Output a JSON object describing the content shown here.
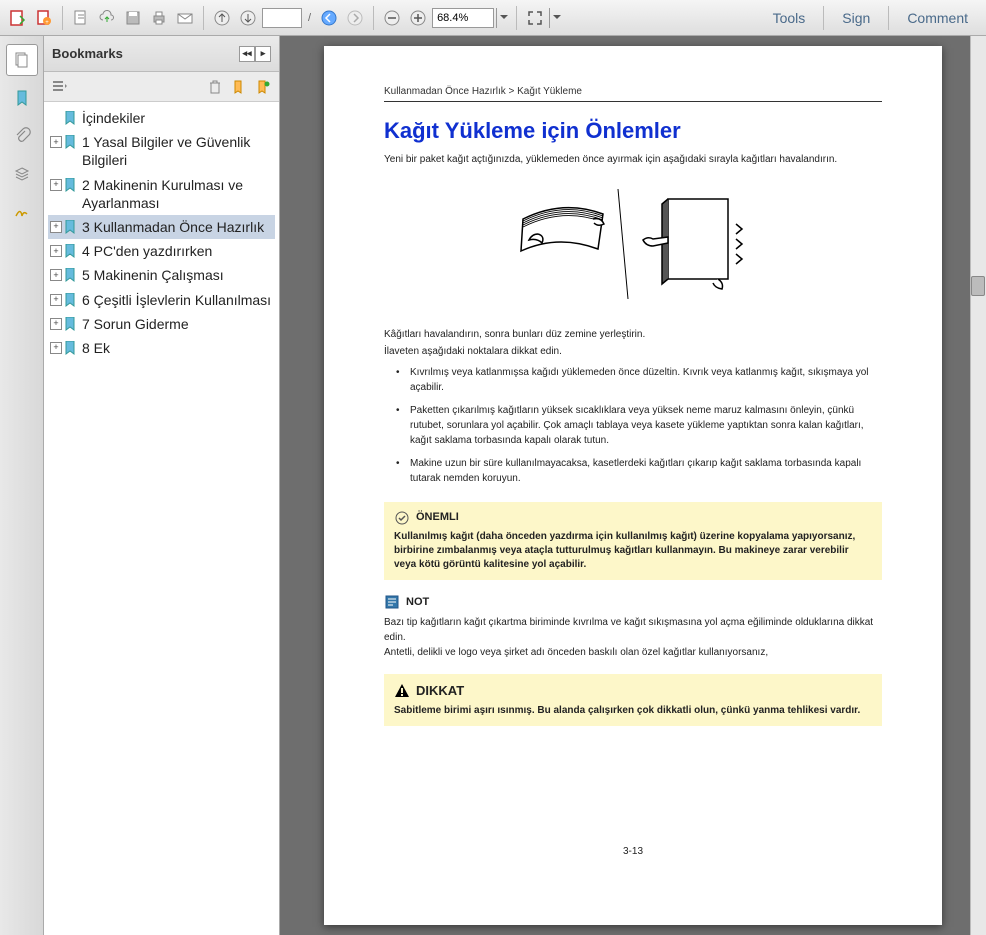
{
  "toolbar": {
    "page_current": "",
    "page_total": "/",
    "zoom": "68.4%",
    "tools_label": "Tools",
    "sign_label": "Sign",
    "comment_label": "Comment"
  },
  "bookmarks": {
    "title": "Bookmarks",
    "items": [
      {
        "label": "İçindekiler",
        "expandable": false
      },
      {
        "label": "1 Yasal Bilgiler ve Güvenlik Bilgileri",
        "expandable": true
      },
      {
        "label": "2 Makinenin Kurulması ve Ayarlanması",
        "expandable": true
      },
      {
        "label": "3 Kullanmadan Önce Hazırlık",
        "expandable": true,
        "selected": true
      },
      {
        "label": "4 PC'den yazdırırken",
        "expandable": true
      },
      {
        "label": "5 Makinenin Çalışması",
        "expandable": true
      },
      {
        "label": "6 Çeşitli İşlevlerin Kullanılması",
        "expandable": true
      },
      {
        "label": "7 Sorun Giderme",
        "expandable": true
      },
      {
        "label": "8 Ek",
        "expandable": true
      }
    ]
  },
  "document": {
    "breadcrumb": "Kullanmadan Önce Hazırlık > Kağıt Yükleme",
    "title": "Kağıt Yükleme için Önlemler",
    "intro": "Yeni bir paket kağıt açtığınızda, yüklemeden önce ayırmak için aşağıdaki sırayla kağıtları havalandırın.",
    "line1": "Kâğıtları havalandırın, sonra bunları düz zemine yerleştirin.",
    "line2": "İlaveten aşağıdaki noktalara dikkat edin.",
    "bullets": [
      "Kıvrılmış veya katlanmışsa kağıdı yüklemeden önce düzeltin. Kıvrık veya katlanmış kağıt, sıkışmaya yol açabilir.",
      "Paketten çıkarılmış kağıtların yüksek sıcaklıklara veya yüksek neme maruz kalmasını önleyin, çünkü rutubet, sorunlara yol açabilir. Çok amaçlı tablaya veya kasete yükleme yaptıktan sonra kalan kağıtları, kağıt saklama torbasında kapalı olarak tutun.",
      "Makine uzun bir süre kullanılmayacaksa, kasetlerdeki kağıtları çıkarıp kağıt saklama torbasında kapalı tutarak nemden koruyun."
    ],
    "important": {
      "header": "ÖNEMLI",
      "body": "Kullanılmış kağıt (daha önceden yazdırma için kullanılmış kağıt) üzerine kopyalama yapıyorsanız, birbirine zımbalanmış veya ataçla tutturulmuş kağıtları kullanmayın. Bu makineye zarar verebilir veya kötü görüntü kalitesine yol açabilir."
    },
    "note": {
      "header": "NOT",
      "body1": "Bazı tip kağıtların kağıt çıkartma biriminde kıvrılma ve kağıt sıkışmasına yol açma eğiliminde olduklarına dikkat edin.",
      "body2_prefix": "Antetli, delikli ve logo veya şirket adı önceden baskılı olan özel kağıtlar kullanıyorsanız,",
      "body2_link": ""
    },
    "caution": {
      "header": "DIKKAT",
      "body": "Sabitleme birimi aşırı ısınmış. Bu alanda çalışırken çok dikkatli olun, çünkü yanma tehlikesi vardır."
    },
    "page_number": "3-13"
  }
}
